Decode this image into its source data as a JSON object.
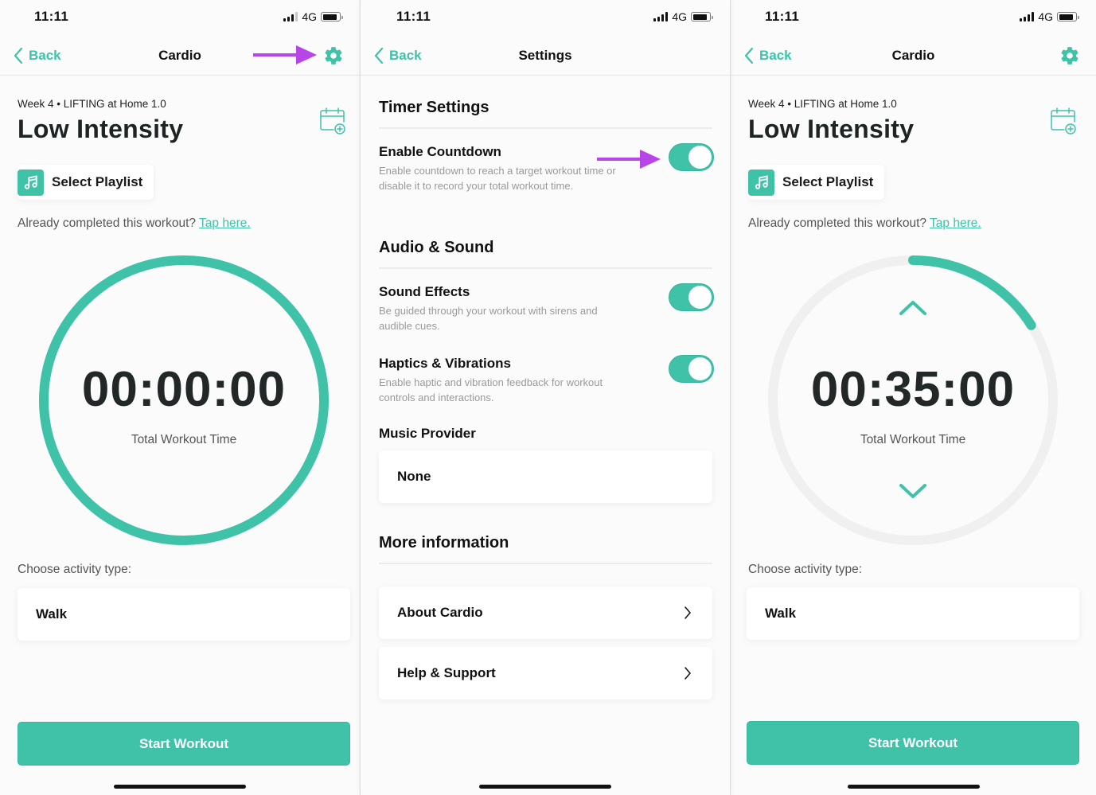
{
  "colors": {
    "accent": "#40c2a9",
    "annotation_arrow": "#b845e8",
    "ring_track": "#f0f0f0",
    "text_dark": "#1d2424"
  },
  "status_bar": {
    "time": "11:11",
    "network": "4G"
  },
  "screen_cardio_before": {
    "nav": {
      "back_label": "Back",
      "title": "Cardio",
      "settings_icon": "gear-icon"
    },
    "subtitle": "Week 4 • LIFTING at Home 1.0",
    "title": "Low Intensity",
    "calendar_icon": "calendar-add-icon",
    "playlist": {
      "icon": "music-note-icon",
      "label": "Select Playlist"
    },
    "completed": {
      "text": "Already completed this workout?",
      "link": "Tap here."
    },
    "timer": {
      "value": "00:00:00",
      "label": "Total Workout Time",
      "countdown_enabled": false,
      "progress": 1.0
    },
    "activity": {
      "label": "Choose activity type:",
      "selected": "Walk"
    },
    "start_button": "Start Workout",
    "annotation": "arrow pointing to settings gear"
  },
  "screen_settings": {
    "nav": {
      "back_label": "Back",
      "title": "Settings"
    },
    "sections": [
      {
        "title": "Timer Settings",
        "items": [
          {
            "label": "Enable Countdown",
            "description": "Enable countdown to reach a target workout time or disable it to record your total workout time.",
            "enabled": true
          }
        ]
      },
      {
        "title": "Audio & Sound",
        "items": [
          {
            "label": "Sound Effects",
            "description": "Be guided through your workout with sirens and audible cues.",
            "enabled": true
          },
          {
            "label": "Haptics & Vibrations",
            "description": "Enable haptic and vibration feedback for workout controls and interactions.",
            "enabled": true
          }
        ]
      }
    ],
    "music_provider": {
      "label": "Music Provider",
      "value": "None"
    },
    "more_info": {
      "title": "More information",
      "links": [
        {
          "label": "About Cardio"
        },
        {
          "label": "Help & Support"
        }
      ]
    },
    "annotation": "arrow pointing to Enable Countdown toggle"
  },
  "screen_cardio_after": {
    "nav": {
      "back_label": "Back",
      "title": "Cardio",
      "settings_icon": "gear-icon"
    },
    "subtitle": "Week 4 • LIFTING at Home 1.0",
    "title": "Low Intensity",
    "calendar_icon": "calendar-add-icon",
    "playlist": {
      "icon": "music-note-icon",
      "label": "Select Playlist"
    },
    "completed": {
      "text": "Already completed this workout?",
      "link": "Tap here."
    },
    "timer": {
      "value": "00:35:00",
      "label": "Total Workout Time",
      "countdown_enabled": true,
      "progress": 0.16,
      "increase_icon": "chevron-up-icon",
      "decrease_icon": "chevron-down-icon"
    },
    "activity": {
      "label": "Choose activity type:",
      "selected": "Walk"
    },
    "start_button": "Start Workout"
  }
}
